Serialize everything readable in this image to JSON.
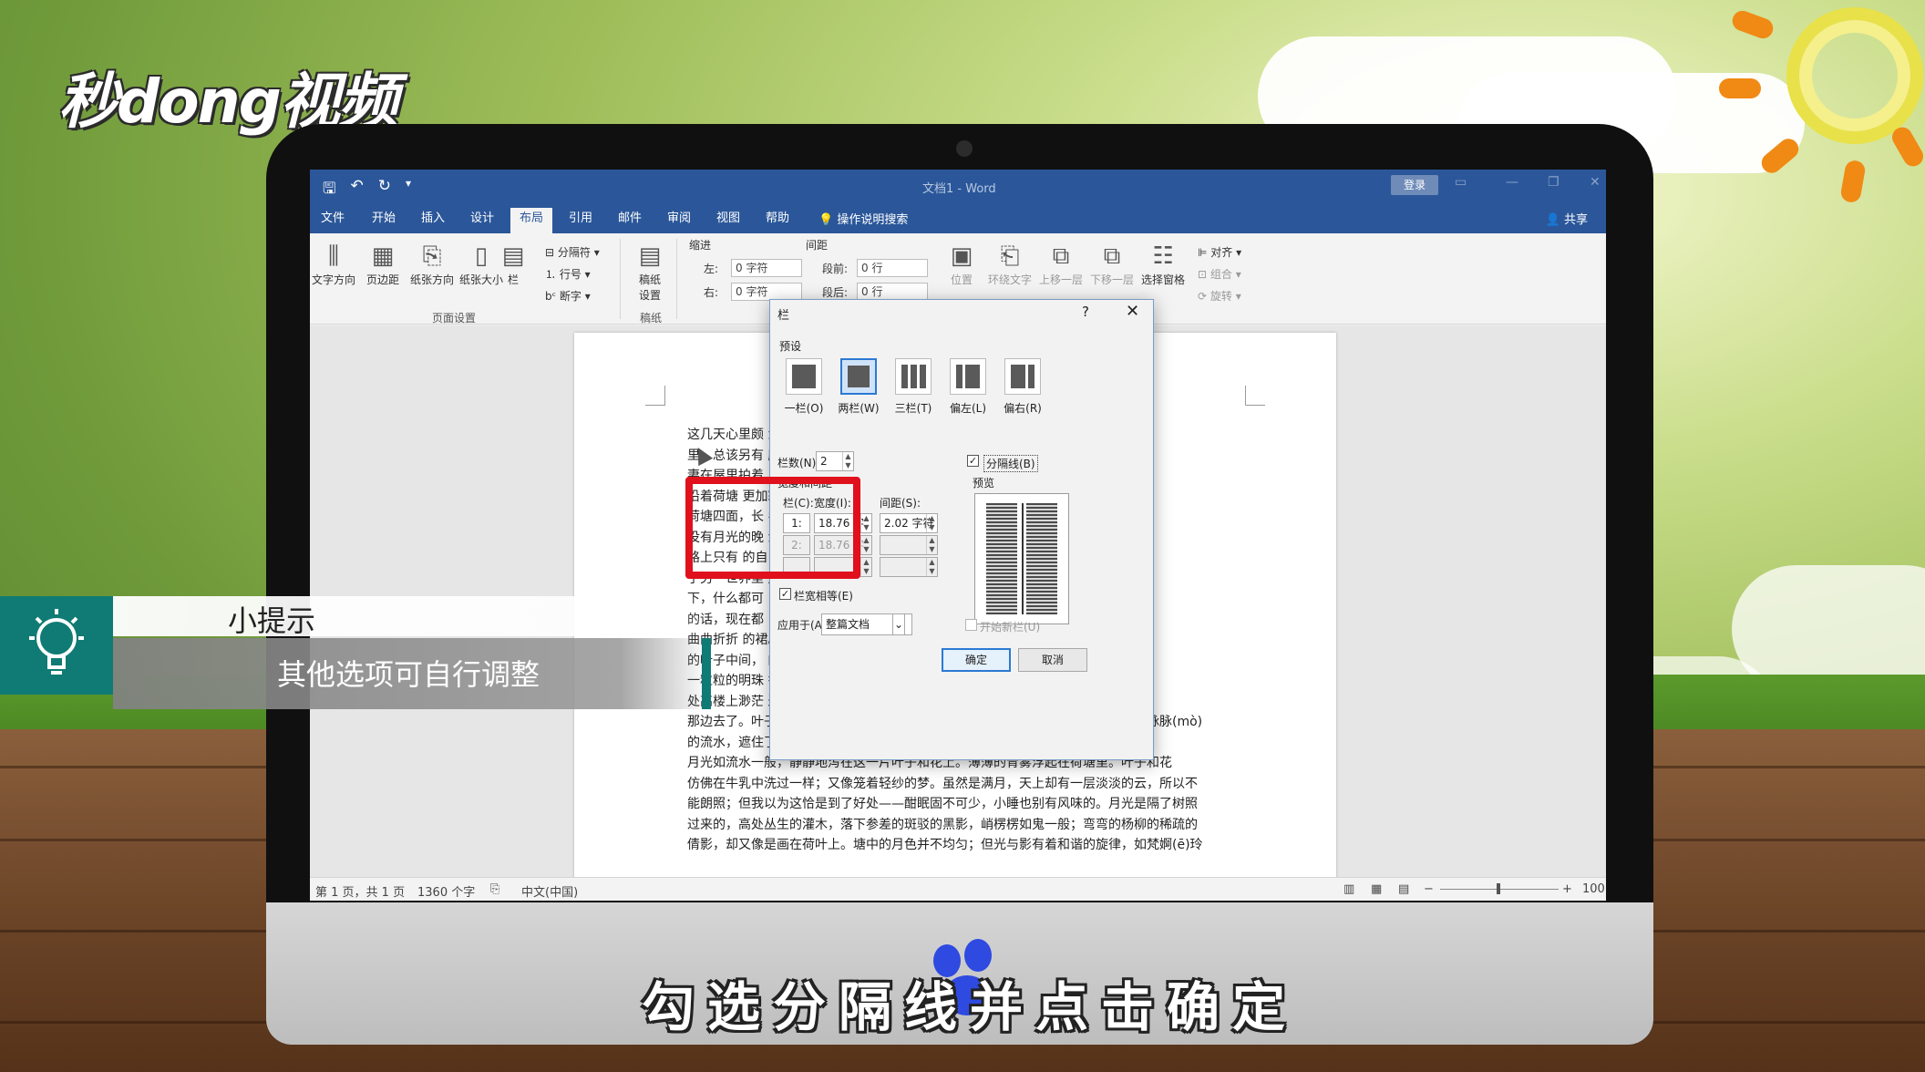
{
  "watermark": {
    "logo": "秒dong视频"
  },
  "word": {
    "doc_title": "文档1 - Word",
    "login": "登录",
    "tabs": [
      "文件",
      "开始",
      "插入",
      "设计",
      "布局",
      "引用",
      "邮件",
      "审阅",
      "视图",
      "帮助"
    ],
    "active_tab": "布局",
    "tell_me": "操作说明搜索",
    "share": "共享",
    "ribbon": {
      "page_setup": {
        "buttons": [
          "文字方向",
          "页边距",
          "纸张方向",
          "纸张大小",
          "栏"
        ],
        "small": [
          "分隔符",
          "行号",
          "断字"
        ],
        "label": "页面设置"
      },
      "draft": {
        "button": "稿纸设置",
        "label": "稿纸"
      },
      "indent": {
        "label": "缩进",
        "left_label": "左:",
        "left_value": "0 字符",
        "right_label": "右:",
        "right_value": "0 字符"
      },
      "spacing": {
        "label": "间距",
        "before_label": "段前:",
        "before_value": "0 行",
        "after_label": "段后:",
        "after_value": "0 行"
      },
      "arrange": {
        "buttons": [
          "位置",
          "环绕文字",
          "上移一层",
          "下移一层",
          "选择窗格"
        ],
        "small": [
          "对齐",
          "组合",
          "旋转"
        ]
      }
    },
    "document_lines": [
      "这几天心里颇                                                满月的月光",
      "里，总该另有                                                 所不见了；",
      "妻在屋里拍着",
      "    沿着荷塘                                                 更加寂寞。",
      "荷塘四面，长                                                 名字的树。",
      "没有月光的晚                                                 淡淡的。↵",
      "    路上只有                                                 的自己，到",
      "了另一世界里                                                 这苍茫的月",
      "下，什么都可                                                 ，一定要说",
      "的话，现在都",
      "    曲曲折折                                                 的裙。层层",
      "的叶子中间，                                                 的；正如",
      "一粒粒的明珠                                                 香，仿佛远",
      "处高楼上渺茫                                                 过荷塘的",
      "那边去了。叶子本是肩并肩密地挨着，这便宛然有了一道凝碧的波痕。叶子底下是脉脉(mò)",
      "的流水，遮住了，不能见一些颜色；而叶子却更见风致了。↵",
      "    月光如流水一般，静静地泻在这一片叶子和花上。薄薄的青雾浮起在荷塘里。叶子和花",
      "仿佛在牛乳中洗过一样；又像笼着轻纱的梦。虽然是满月，天上却有一层淡淡的云，所以不",
      "能朗照；但我以为这恰是到了好处——酣眠固不可少，小睡也别有风味的。月光是隔了树照",
      "过来的，高处丛生的灌木，落下参差的斑驳的黑影，峭楞楞如鬼一般；弯弯的杨柳的稀疏的",
      "倩影，却又像是画在荷叶上。塘中的月色并不均匀；但光与影有着和谐的旋律，如梵婀(ē)玲"
    ],
    "status": {
      "page": "第 1 页，共 1 页",
      "words": "1360 个字",
      "language": "中文(中国)",
      "zoom": "100"
    }
  },
  "dialog": {
    "title": "栏",
    "help": "?",
    "close": "✕",
    "presets_label": "预设",
    "presets": [
      "一栏(O)",
      "两栏(W)",
      "三栏(T)",
      "偏左(L)",
      "偏右(R)"
    ],
    "selected_preset": "两栏(W)",
    "columns_label": "栏数(N):",
    "columns_value": "2",
    "separator_label": "分隔线(B)",
    "separator_checked": true,
    "width_spacing_label": "宽度和间距",
    "col_header": "栏(C):",
    "width_header": "宽度(I):",
    "spacing_header": "间距(S):",
    "rows": [
      {
        "num": "1:",
        "width": "18.76 字符",
        "spacing": "2.02 字符",
        "enabled": true
      },
      {
        "num": "2:",
        "width": "18.76 字符",
        "spacing": "",
        "enabled": false
      },
      {
        "num": "",
        "width": "",
        "spacing": "",
        "enabled": false
      }
    ],
    "equal_width_label": "栏宽相等(E)",
    "equal_width_checked": true,
    "preview_label": "预览",
    "apply_label": "应用于(A):",
    "apply_value": "整篇文档",
    "new_column_label": "开始新栏(U)",
    "ok": "确定",
    "cancel": "取消"
  },
  "tip": {
    "title": "小提示",
    "text": "其他选项可自行调整"
  },
  "caption": "勾选分隔线并点击确定",
  "colors": {
    "word_blue": "#2b579a",
    "highlight_red": "#e0101c",
    "tip_teal": "#0f7b74"
  }
}
